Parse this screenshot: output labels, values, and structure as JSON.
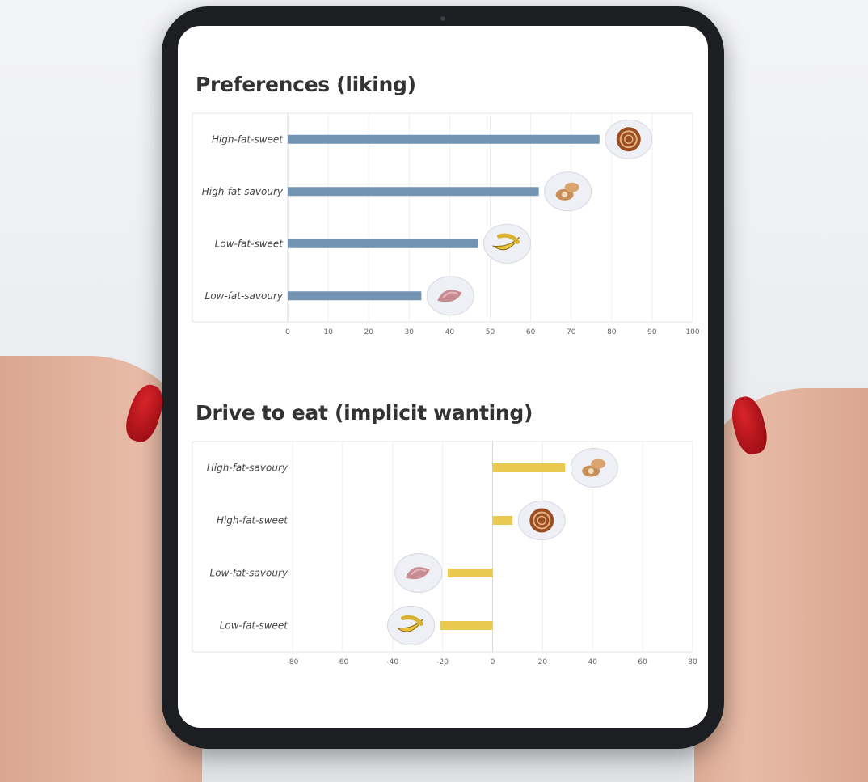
{
  "chart_data": [
    {
      "type": "bar",
      "orientation": "horizontal",
      "title": "Preferences (liking)",
      "categories": [
        "High-fat-sweet",
        "High-fat-savoury",
        "Low-fat-sweet",
        "Low-fat-savoury"
      ],
      "values": [
        77,
        62,
        47,
        33
      ],
      "icons": [
        "pastry-icon",
        "roll-icon",
        "banana-icon",
        "ham-icon"
      ],
      "xlim": [
        0,
        100
      ],
      "xticks": [
        0,
        10,
        20,
        30,
        40,
        50,
        60,
        70,
        80,
        90,
        100
      ],
      "color": "#7393b3",
      "grid": true
    },
    {
      "type": "bar",
      "orientation": "horizontal",
      "title": "Drive to eat (implicit wanting)",
      "categories": [
        "High-fat-savoury",
        "High-fat-sweet",
        "Low-fat-savoury",
        "Low-fat-sweet"
      ],
      "values": [
        29,
        8,
        -18,
        -21
      ],
      "icons": [
        "roll-icon",
        "pastry-icon",
        "ham-icon",
        "banana-icon"
      ],
      "xlim": [
        -80,
        80
      ],
      "xticks": [
        -80,
        -60,
        -40,
        -20,
        0,
        20,
        40,
        60,
        80
      ],
      "color": "#eac951",
      "grid": true
    }
  ]
}
